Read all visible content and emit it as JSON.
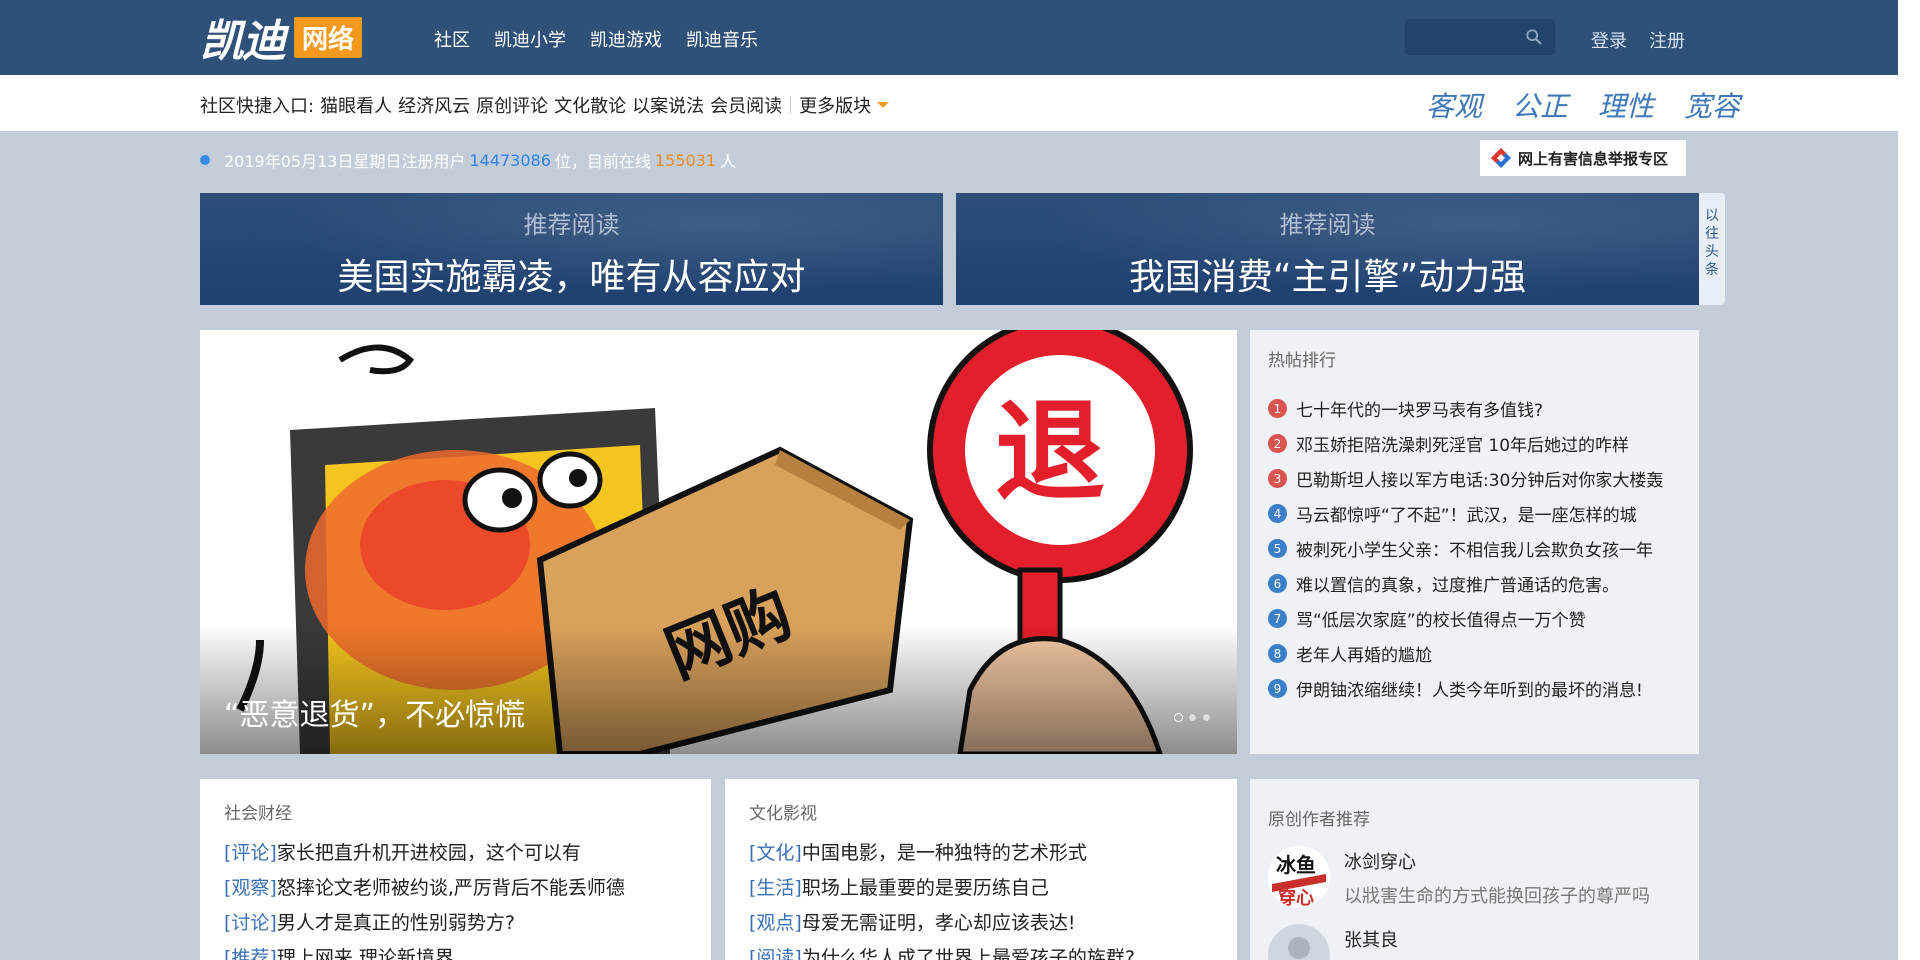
{
  "brand": {
    "logo_text": "凯迪",
    "badge": "网络"
  },
  "nav": {
    "items": [
      "社区",
      "凯迪小学",
      "凯迪游戏",
      "凯迪音乐"
    ]
  },
  "search": {
    "placeholder": ""
  },
  "auth": {
    "login": "登录",
    "register": "注册"
  },
  "quickbar": {
    "label": "社区快捷入口:",
    "links": [
      "猫眼看人",
      "经济风云",
      "原创评论",
      "文化散论",
      "以案说法",
      "会员阅读"
    ],
    "more": "更多版块"
  },
  "motto": [
    "客观",
    "公正",
    "理性",
    "宽容"
  ],
  "stats": {
    "prefix": "2019年05月13日星期日注册用户",
    "registered": "14473086",
    "mid": "位，目前在线",
    "online": "155031",
    "suffix": "人"
  },
  "report": {
    "label": "网上有害信息举报专区"
  },
  "banners": [
    {
      "kicker": "推荐阅读",
      "title": "美国实施霸凌，唯有从容应对"
    },
    {
      "kicker": "推荐阅读",
      "title": "我国消费“主引擎”动力强"
    }
  ],
  "side_tab": {
    "chars": [
      "以",
      "往",
      "头",
      "条"
    ]
  },
  "hero": {
    "caption": "“恶意退货”，不必惊慌",
    "dots": 3,
    "active_dot": 0
  },
  "hot": {
    "title": "热帖排行",
    "items": [
      {
        "rank": "1",
        "text": "七十年代的一块罗马表有多值钱?"
      },
      {
        "rank": "2",
        "text": "邓玉娇拒陪洗澡刺死淫官 10年后她过的咋样"
      },
      {
        "rank": "3",
        "text": "巴勒斯坦人接以军方电话:30分钟后对你家大楼轰"
      },
      {
        "rank": "4",
        "text": "马云都惊呼“了不起”！武汉，是一座怎样的城"
      },
      {
        "rank": "5",
        "text": "被刺死小学生父亲：不相信我儿会欺负女孩一年"
      },
      {
        "rank": "6",
        "text": "难以置信的真象，过度推广普通话的危害。"
      },
      {
        "rank": "7",
        "text": "骂“低层次家庭”的校长值得点一万个赞"
      },
      {
        "rank": "8",
        "text": "老年人再婚的尴尬"
      },
      {
        "rank": "9",
        "text": "伊朗铀浓缩继续！人类今年听到的最坏的消息!"
      }
    ],
    "colors": {
      "top": "#d9534f",
      "rest": "#3a7fc8"
    }
  },
  "sections": [
    {
      "title": "社会财经",
      "items": [
        {
          "tag": "[评论]",
          "text": "家长把直升机开进校园，这个可以有"
        },
        {
          "tag": "[观察]",
          "text": "怒摔论文老师被约谈,严厉背后不能丢师德"
        },
        {
          "tag": "[讨论]",
          "text": "男人才是真正的性别弱势方?"
        },
        {
          "tag": "[推荐]",
          "text": "理上网来 理论新境界"
        }
      ]
    },
    {
      "title": "文化影视",
      "items": [
        {
          "tag": "[文化]",
          "text": "中国电影，是一种独特的艺术形式"
        },
        {
          "tag": "[生活]",
          "text": "职场上最重要的是要历练自己"
        },
        {
          "tag": "[观点]",
          "text": "母爱无需证明，孝心却应该表达!"
        },
        {
          "tag": "[阅读]",
          "text": "为什么华人成了世界上最爱孩子的族群?"
        }
      ]
    }
  ],
  "authors": {
    "title": "原创作者推荐",
    "items": [
      {
        "name": "冰剑穿心",
        "desc": "以戕害生命的方式能换回孩子的尊严吗"
      },
      {
        "name": "张其良",
        "desc": ""
      }
    ]
  }
}
